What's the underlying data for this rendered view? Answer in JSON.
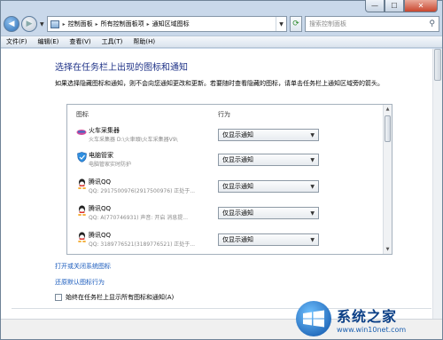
{
  "window": {
    "caption_minimize": "—",
    "caption_maximize": "☐",
    "caption_close": "✕"
  },
  "address": {
    "crumbs": [
      "控制面板",
      "所有控制面板项",
      "通知区域图标"
    ],
    "search_placeholder": "搜索控制面板"
  },
  "menu": [
    "文件(F)",
    "编辑(E)",
    "查看(V)",
    "工具(T)",
    "帮助(H)"
  ],
  "main": {
    "title": "选择在任务栏上出现的图标和通知",
    "description": "如果选择隐藏图标和通知，则不会向您通知更改和更新。若要随时查看隐藏的图标，请单击任务栏上通知区域旁的箭头。",
    "col_icon": "图标",
    "col_behavior": "行为",
    "rows": [
      {
        "name": "火车采集器",
        "sub": "火车采集器 D:\\火車頭\\火车采集器V9\\",
        "behavior": "仅显示通知",
        "icon": "train-icon"
      },
      {
        "name": "电脑管家",
        "sub": "电脑管家实时防护",
        "behavior": "仅显示通知",
        "icon": "shield-icon"
      },
      {
        "name": "腾讯QQ",
        "sub": "QQ: 2917500976(2917500976)  正处于...",
        "behavior": "仅显示通知",
        "icon": "qq-icon"
      },
      {
        "name": "腾讯QQ",
        "sub": "QQ: A(770746931)  声音: 开启  消息提...",
        "behavior": "仅显示通知",
        "icon": "qq-icon"
      },
      {
        "name": "腾讯QQ",
        "sub": "QQ: 3189776521(3189776521)  正处于...",
        "behavior": "仅显示通知",
        "icon": "qq-icon"
      }
    ],
    "link_system_icons": "打开或关闭系统图标",
    "link_restore": "还原默认图标行为",
    "checkbox_label": "始终在任务栏上显示所有图标和通知(A)"
  },
  "watermark": {
    "cn": "系统之家",
    "en": "www.win10net.com"
  },
  "colors": {
    "title": "#1e3287",
    "link": "#1a5bbd",
    "frame": "#c9d8ea"
  }
}
